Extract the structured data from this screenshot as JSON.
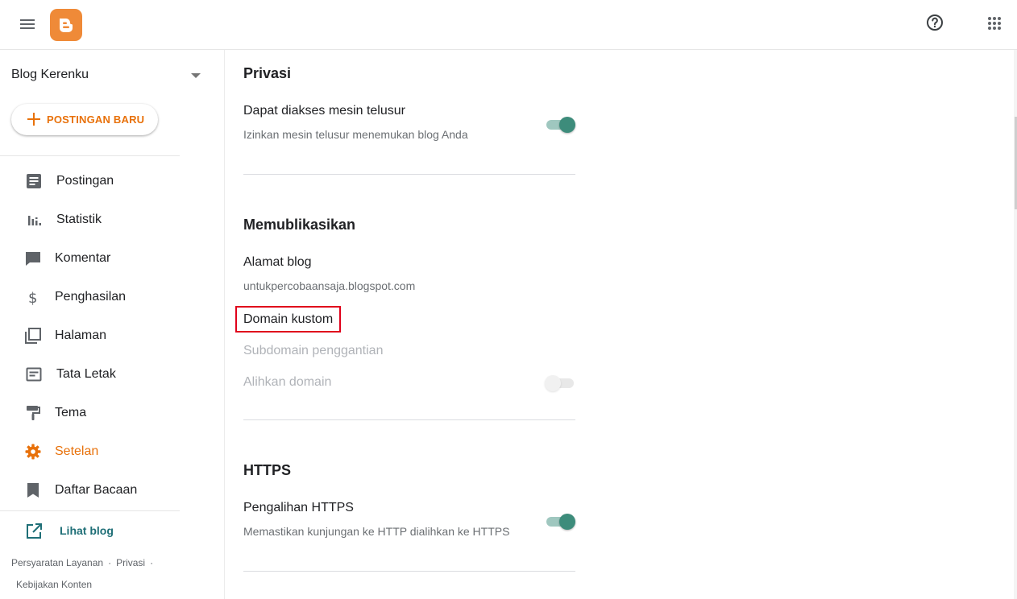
{
  "header": {
    "menu_icon": "hamburger-menu-icon",
    "logo_icon": "blogger-logo-icon",
    "help_icon": "help-circle-icon",
    "apps_icon": "apps-grid-icon"
  },
  "sidebar": {
    "blog_name": "Blog Kerenku",
    "new_post_label": "POSTINGAN BARU",
    "items": [
      {
        "label": "Postingan",
        "icon": "posts-icon"
      },
      {
        "label": "Statistik",
        "icon": "stats-icon"
      },
      {
        "label": "Komentar",
        "icon": "comment-icon"
      },
      {
        "label": "Penghasilan",
        "icon": "dollar-icon"
      },
      {
        "label": "Halaman",
        "icon": "pages-icon"
      },
      {
        "label": "Tata Letak",
        "icon": "layout-icon"
      },
      {
        "label": "Tema",
        "icon": "paint-roller-icon"
      },
      {
        "label": "Setelan",
        "icon": "gear-icon"
      },
      {
        "label": "Daftar Bacaan",
        "icon": "bookmark-icon"
      }
    ],
    "active_item": "Setelan",
    "view_blog_label": "Lihat blog",
    "footer": {
      "terms": "Persyaratan Layanan",
      "privacy": "Privasi",
      "content_policy": "Kebijakan Konten",
      "separator": "·"
    }
  },
  "main": {
    "privacy": {
      "title": "Privasi",
      "search_engine": {
        "title": "Dapat diakses mesin telusur",
        "subtitle": "Izinkan mesin telusur menemukan blog Anda",
        "enabled": true
      }
    },
    "publishing": {
      "title": "Memublikasikan",
      "blog_address": {
        "title": "Alamat blog",
        "value": "untukpercobaansaja.blogspot.com"
      },
      "custom_domain": "Domain kustom",
      "fallback_subdomain": "Subdomain penggantian",
      "redirect_domain": {
        "title": "Alihkan domain",
        "enabled": false
      }
    },
    "https": {
      "title": "HTTPS",
      "redirect": {
        "title": "Pengalihan HTTPS",
        "subtitle": "Memastikan kunjungan ke HTTP dialihkan ke HTTPS",
        "enabled": true
      }
    }
  },
  "colors": {
    "accent": "#e8710a",
    "toggle_on": "#3d8c7b",
    "highlight": "#e0001b"
  }
}
